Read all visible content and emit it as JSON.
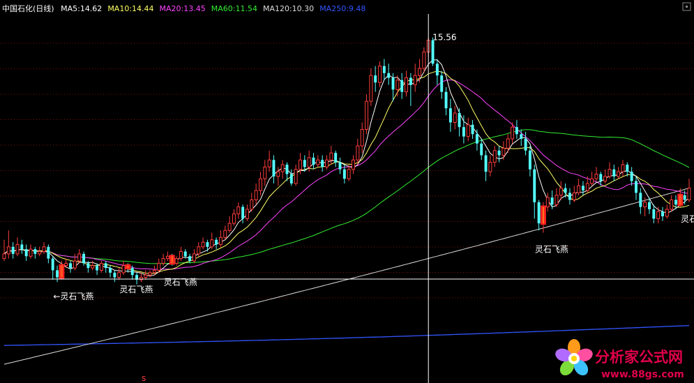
{
  "chart_data": {
    "type": "candlestick",
    "title": "中国石化(日线)",
    "ma_legend": [
      {
        "label": "MA5:14.62",
        "color": "#ffffff"
      },
      {
        "label": "MA10:14.44",
        "color": "#ffff66"
      },
      {
        "label": "MA20:13.45",
        "color": "#ff44ff"
      },
      {
        "label": "MA60:11.54",
        "color": "#33ee33"
      },
      {
        "label": "MA120:10.30",
        "color": "#dddddd"
      },
      {
        "label": "MA250:9.48",
        "color": "#3355ff"
      }
    ],
    "ylim": [
      8.2,
      16.0
    ],
    "grid": true,
    "up_color": "#ff3c3c",
    "down_color": "#54ffff",
    "high_marker": "15.56",
    "signal_label": "灵石飞燕",
    "signal_labels": [
      {
        "text": "←灵石飞燕",
        "at_candle": 13
      },
      {
        "text": "灵石飞燕",
        "at_candle": 28
      },
      {
        "text": "灵石飞燕",
        "at_candle": 38
      },
      {
        "text": "灵石飞燕",
        "at_candle": 122
      },
      {
        "text": "灵石飞燕",
        "at_candle": 155
      }
    ],
    "signal_candles": [
      13,
      28,
      38,
      122,
      153
    ],
    "bottom_marker": "s",
    "candles": [
      [
        10.85,
        10.95,
        11.25,
        10.8
      ],
      [
        10.95,
        11.1,
        11.45,
        10.85
      ],
      [
        11.1,
        10.95,
        11.2,
        10.85
      ],
      [
        10.95,
        11.15,
        11.3,
        10.9
      ],
      [
        11.15,
        11.05,
        11.25,
        10.95
      ],
      [
        11.05,
        10.9,
        11.15,
        10.8
      ],
      [
        10.9,
        11.05,
        11.15,
        10.85
      ],
      [
        11.05,
        10.95,
        11.1,
        10.85
      ],
      [
        10.95,
        11.0,
        11.1,
        10.9
      ],
      [
        11.0,
        11.1,
        11.2,
        10.95
      ],
      [
        11.1,
        10.85,
        11.15,
        10.75
      ],
      [
        10.85,
        10.6,
        10.9,
        10.4
      ],
      [
        10.6,
        10.45,
        10.7,
        10.35
      ],
      [
        10.45,
        10.7,
        10.8,
        10.4
      ],
      [
        10.7,
        10.75,
        10.85,
        10.65
      ],
      [
        10.75,
        10.65,
        10.8,
        10.55
      ],
      [
        10.65,
        10.8,
        10.95,
        10.6
      ],
      [
        10.8,
        10.95,
        11.05,
        10.75
      ],
      [
        10.95,
        10.75,
        11.0,
        10.7
      ],
      [
        10.75,
        10.65,
        10.8,
        10.55
      ],
      [
        10.65,
        10.7,
        10.8,
        10.6
      ],
      [
        10.7,
        10.6,
        10.75,
        10.5
      ],
      [
        10.6,
        10.75,
        10.8,
        10.55
      ],
      [
        10.75,
        10.65,
        10.8,
        10.55
      ],
      [
        10.65,
        10.55,
        10.7,
        10.45
      ],
      [
        10.55,
        10.45,
        10.6,
        10.35
      ],
      [
        10.45,
        10.55,
        10.65,
        10.4
      ],
      [
        10.55,
        10.7,
        10.8,
        10.5
      ],
      [
        10.7,
        10.65,
        10.75,
        10.55
      ],
      [
        10.65,
        10.5,
        10.7,
        10.4
      ],
      [
        10.5,
        10.4,
        10.55,
        10.3
      ],
      [
        10.4,
        10.45,
        10.55,
        10.35
      ],
      [
        10.45,
        10.5,
        10.6,
        10.4
      ],
      [
        10.5,
        10.55,
        10.6,
        10.45
      ],
      [
        10.55,
        10.6,
        10.7,
        10.5
      ],
      [
        10.6,
        10.75,
        10.85,
        10.55
      ],
      [
        10.75,
        10.85,
        10.95,
        10.7
      ],
      [
        10.85,
        10.9,
        11.0,
        10.8
      ],
      [
        10.9,
        10.75,
        10.95,
        10.7
      ],
      [
        10.75,
        10.85,
        10.9,
        10.7
      ],
      [
        10.85,
        11.0,
        11.1,
        10.8
      ],
      [
        11.0,
        10.9,
        11.05,
        10.85
      ],
      [
        10.9,
        10.8,
        10.95,
        10.75
      ],
      [
        10.8,
        10.95,
        11.05,
        10.75
      ],
      [
        10.95,
        11.1,
        11.2,
        10.9
      ],
      [
        11.1,
        11.2,
        11.3,
        11.05
      ],
      [
        11.2,
        11.1,
        11.25,
        11.0
      ],
      [
        11.1,
        11.25,
        11.4,
        11.05
      ],
      [
        11.25,
        11.15,
        11.3,
        11.05
      ],
      [
        11.15,
        11.3,
        11.45,
        11.1
      ],
      [
        11.3,
        11.45,
        11.55,
        11.25
      ],
      [
        11.45,
        11.6,
        11.75,
        11.4
      ],
      [
        11.6,
        11.8,
        11.9,
        11.55
      ],
      [
        11.8,
        11.95,
        12.05,
        11.7
      ],
      [
        11.95,
        11.7,
        12.0,
        11.6
      ],
      [
        11.7,
        11.9,
        12.0,
        11.65
      ],
      [
        11.9,
        12.1,
        12.25,
        11.85
      ],
      [
        12.1,
        12.3,
        12.45,
        12.0
      ],
      [
        12.3,
        12.55,
        12.7,
        12.2
      ],
      [
        12.55,
        12.8,
        12.95,
        12.4
      ],
      [
        12.8,
        12.95,
        13.15,
        12.7
      ],
      [
        12.95,
        12.6,
        13.05,
        12.45
      ],
      [
        12.6,
        12.7,
        12.8,
        12.4
      ],
      [
        12.7,
        12.85,
        12.95,
        12.55
      ],
      [
        12.85,
        12.65,
        12.9,
        12.5
      ],
      [
        12.65,
        12.45,
        12.75,
        12.4
      ],
      [
        12.45,
        12.75,
        12.85,
        12.4
      ],
      [
        12.75,
        12.95,
        13.1,
        12.65
      ],
      [
        12.95,
        12.8,
        13.05,
        12.7
      ],
      [
        12.8,
        13.0,
        13.15,
        12.7
      ],
      [
        13.0,
        12.85,
        13.1,
        12.75
      ],
      [
        12.85,
        12.95,
        13.05,
        12.8
      ],
      [
        12.95,
        12.8,
        13.05,
        12.7
      ],
      [
        12.8,
        12.95,
        13.05,
        12.75
      ],
      [
        12.95,
        13.1,
        13.25,
        12.85
      ],
      [
        13.1,
        12.9,
        13.15,
        12.8
      ],
      [
        12.9,
        12.75,
        13.0,
        12.65
      ],
      [
        12.75,
        12.55,
        12.85,
        12.45
      ],
      [
        12.55,
        12.75,
        12.85,
        12.5
      ],
      [
        12.75,
        12.95,
        13.05,
        12.65
      ],
      [
        12.95,
        13.25,
        13.4,
        12.85
      ],
      [
        13.25,
        13.6,
        13.75,
        13.1
      ],
      [
        13.6,
        14.2,
        14.35,
        13.5
      ],
      [
        14.2,
        14.75,
        14.9,
        14.1
      ],
      [
        14.75,
        14.6,
        14.95,
        14.4
      ],
      [
        14.6,
        14.95,
        15.05,
        14.5
      ],
      [
        14.95,
        14.8,
        15.1,
        14.65
      ],
      [
        14.8,
        14.7,
        15.0,
        14.55
      ],
      [
        14.7,
        14.45,
        14.8,
        14.2
      ],
      [
        14.45,
        14.65,
        14.75,
        14.3
      ],
      [
        14.65,
        14.4,
        14.8,
        14.25
      ],
      [
        14.4,
        14.7,
        14.85,
        14.3
      ],
      [
        14.7,
        14.55,
        14.8,
        14.1
      ],
      [
        14.55,
        14.75,
        15.0,
        14.4
      ],
      [
        14.75,
        14.9,
        15.1,
        14.6
      ],
      [
        14.9,
        15.25,
        15.35,
        14.8
      ],
      [
        15.25,
        15.5,
        15.56,
        15.15
      ],
      [
        15.5,
        15.0,
        15.56,
        14.95
      ],
      [
        15.0,
        14.75,
        15.1,
        14.55
      ],
      [
        14.75,
        14.4,
        14.85,
        14.25
      ],
      [
        14.4,
        14.05,
        14.5,
        13.9
      ],
      [
        14.05,
        13.75,
        14.25,
        13.55
      ],
      [
        13.75,
        13.95,
        14.1,
        13.6
      ],
      [
        13.95,
        13.65,
        14.05,
        13.45
      ],
      [
        13.65,
        13.45,
        13.9,
        13.3
      ],
      [
        13.45,
        13.7,
        13.85,
        13.35
      ],
      [
        13.7,
        13.5,
        13.8,
        13.4
      ],
      [
        13.5,
        13.3,
        13.6,
        13.15
      ],
      [
        13.3,
        13.05,
        13.4,
        12.95
      ],
      [
        13.05,
        12.7,
        13.15,
        12.5
      ],
      [
        12.7,
        12.9,
        13.05,
        12.6
      ],
      [
        12.9,
        13.15,
        13.25,
        12.8
      ],
      [
        13.15,
        13.05,
        13.25,
        12.9
      ],
      [
        13.05,
        13.2,
        13.35,
        12.95
      ],
      [
        13.2,
        13.4,
        13.5,
        13.1
      ],
      [
        13.4,
        13.65,
        13.75,
        13.3
      ],
      [
        13.65,
        13.5,
        13.8,
        13.4
      ],
      [
        13.5,
        13.4,
        13.6,
        13.25
      ],
      [
        13.4,
        13.15,
        13.55,
        13.05
      ],
      [
        13.15,
        12.75,
        13.25,
        12.6
      ],
      [
        12.75,
        12.05,
        12.85,
        11.7
      ],
      [
        12.05,
        11.6,
        12.1,
        11.45
      ],
      [
        11.6,
        11.95,
        12.05,
        11.4
      ],
      [
        11.95,
        12.15,
        12.25,
        11.85
      ],
      [
        12.15,
        12.0,
        12.3,
        11.9
      ],
      [
        12.0,
        12.2,
        12.35,
        11.95
      ],
      [
        12.2,
        12.35,
        12.5,
        12.1
      ],
      [
        12.35,
        12.25,
        12.45,
        12.15
      ],
      [
        12.25,
        12.1,
        12.35,
        12.0
      ],
      [
        12.1,
        12.25,
        12.4,
        12.05
      ],
      [
        12.25,
        12.4,
        12.55,
        12.2
      ],
      [
        12.4,
        12.3,
        12.5,
        12.2
      ],
      [
        12.3,
        12.45,
        12.6,
        12.25
      ],
      [
        12.45,
        12.55,
        12.7,
        12.4
      ],
      [
        12.55,
        12.65,
        12.8,
        12.5
      ],
      [
        12.65,
        12.5,
        12.7,
        12.4
      ],
      [
        12.5,
        12.6,
        12.75,
        12.45
      ],
      [
        12.6,
        12.75,
        12.9,
        12.55
      ],
      [
        12.75,
        12.6,
        12.85,
        12.5
      ],
      [
        12.6,
        12.7,
        12.8,
        12.55
      ],
      [
        12.7,
        12.85,
        12.95,
        12.6
      ],
      [
        12.85,
        12.7,
        12.9,
        12.6
      ],
      [
        12.7,
        12.5,
        12.8,
        12.4
      ],
      [
        12.5,
        12.25,
        12.6,
        12.1
      ],
      [
        12.25,
        11.95,
        12.35,
        11.8
      ],
      [
        11.95,
        12.05,
        12.15,
        11.75
      ],
      [
        12.05,
        11.9,
        12.15,
        11.8
      ],
      [
        11.9,
        11.7,
        12.0,
        11.6
      ],
      [
        11.7,
        11.85,
        11.95,
        11.6
      ],
      [
        11.85,
        11.75,
        11.95,
        11.65
      ],
      [
        11.75,
        11.9,
        12.0,
        11.7
      ],
      [
        11.9,
        12.1,
        12.2,
        11.85
      ],
      [
        12.1,
        12.0,
        12.2,
        11.9
      ],
      [
        12.0,
        12.2,
        12.35,
        11.95
      ],
      [
        12.2,
        12.1,
        12.3,
        12.0
      ],
      [
        12.1,
        12.35,
        12.55,
        12.05
      ]
    ]
  },
  "watermark": {
    "text": "分析家公式网",
    "url": "www.88gs.com"
  }
}
